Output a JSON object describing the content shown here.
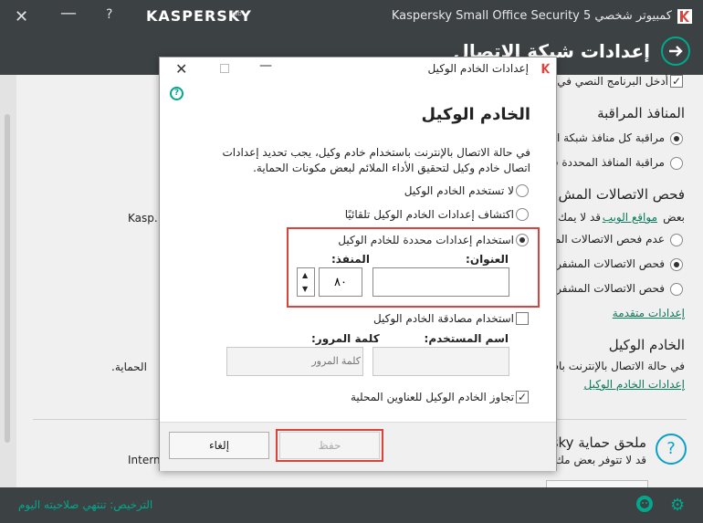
{
  "app": {
    "window_title": "Kaspersky Small Office Security 5 كمبيوتر شخصي",
    "logo_text": "KASPERSKY",
    "help_glyph": "?",
    "page_title": "إعدادات شبكة الاتصال"
  },
  "background": {
    "checkbox_row": "أدخل البرنامج النصي في",
    "section_ports": "المنافذ المراقبة",
    "ports_all": "مراقبة كل منافذ شبكة الا",
    "ports_selected": "مراقبة المنافذ المحددة فق",
    "section_encrypted": "فحص الاتصالات المش",
    "encrypted_desc_prefix": "بعض",
    "encrypted_desc_link": "مواقع الويب",
    "encrypted_desc_suffix": "قد لا يمك",
    "left_fragment_1": "Kasp.",
    "enc_opt_1": "عدم فحص الاتصالات الم",
    "enc_opt_2": "فحص الاتصالات المشفرة",
    "enc_opt_3": "فحص الاتصالات المشفرة",
    "advanced_link": "إعدادات متقدمة",
    "section_proxy": "الخادم الوكيل",
    "proxy_desc": "في حالة الاتصال بالإنترنت باس",
    "left_fragment_2": "الحماية.",
    "proxy_settings_link": "إعدادات الخادم الوكيل",
    "section_plugin": "ملحق حماية sky",
    "plugin_desc": "قد لا تتوفر بعض مك",
    "left_fragment_3": "Intern."
  },
  "bottom": {
    "license_text": "الترخيص: تنتهي صلاحيته اليوم"
  },
  "dialog": {
    "title": "إعدادات الخادم الوكيل",
    "heading": "الخادم الوكيل",
    "description": "في حالة الاتصال بالإنترنت باستخدام خادم وكيل، يجب تحديد إعدادات اتصال خادم وكيل لتحقيق الأداء الملائم لبعض مكونات الحماية.",
    "options": [
      {
        "label": "لا تستخدم الخادم الوكيل",
        "selected": false
      },
      {
        "label": "اكتشاف إعدادات الخادم الوكيل تلقائيًا",
        "selected": false
      },
      {
        "label": "استخدام إعدادات محددة للخادم الوكيل",
        "selected": true
      }
    ],
    "address_label": "العنوان:",
    "address_value": "",
    "port_label": "المنفذ:",
    "port_value": "٨٠",
    "auth_label": "استخدام مصادقة الخادم الوكيل",
    "username_label": "اسم المستخدم:",
    "username_value": "",
    "password_label": "كلمة المرور:",
    "password_placeholder": "كلمة المرور",
    "bypass_label": "تجاوز الخادم الوكيل للعناوين المحلية",
    "bypass_checked": true,
    "save_label": "حفظ",
    "cancel_label": "إلغاء"
  },
  "colors": {
    "dark_bar": "#3c4143",
    "accent_green": "#00a88e",
    "highlight_red": "#d9433c",
    "kaspersky_red": "#d9433c"
  }
}
